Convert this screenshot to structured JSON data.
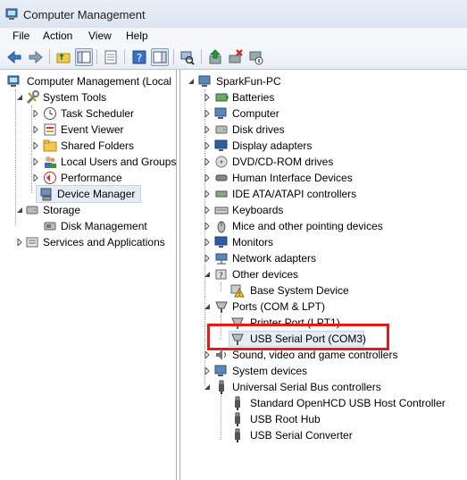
{
  "window": {
    "title": "Computer Management"
  },
  "menu": [
    "File",
    "Action",
    "View",
    "Help"
  ],
  "toolbar": {
    "back": "back-arrow-icon",
    "forward": "forward-arrow-icon",
    "up": "up-folder-icon",
    "show_tree": "console-tree-icon",
    "properties": "properties-icon",
    "help": "help-icon",
    "action_pane": "action-pane-icon",
    "scan": "scan-hardware-icon",
    "update": "update-driver-icon",
    "uninstall": "uninstall-icon",
    "disable": "disable-device-icon"
  },
  "left_tree": {
    "root": "Computer Management (Local",
    "system_tools": "System Tools",
    "task_scheduler": "Task Scheduler",
    "event_viewer": "Event Viewer",
    "shared_folders": "Shared Folders",
    "local_users": "Local Users and Groups",
    "performance": "Performance",
    "device_manager": "Device Manager",
    "storage": "Storage",
    "disk_management": "Disk Management",
    "services": "Services and Applications"
  },
  "right_tree": {
    "root": "SparkFun-PC",
    "categories": [
      "Batteries",
      "Computer",
      "Disk drives",
      "Display adapters",
      "DVD/CD-ROM drives",
      "Human Interface Devices",
      "IDE ATA/ATAPI controllers",
      "Keyboards",
      "Mice and other pointing devices",
      "Monitors",
      "Network adapters"
    ],
    "other_devices": "Other devices",
    "base_system_device": "Base System Device",
    "ports": "Ports (COM & LPT)",
    "printer_port": "Printer Port (LPT1)",
    "usb_serial_port": "USB Serial Port (COM3)",
    "sound": "Sound, video and game controllers",
    "system_devices": "System devices",
    "usb_controllers": "Universal Serial Bus controllers",
    "usb_children": [
      "Standard OpenHCD USB Host Controller",
      "USB Root Hub",
      "USB Serial Converter"
    ]
  },
  "colors": {
    "highlight_box": "#e01c1c",
    "selection": "#e5ecf5",
    "title_bg": "#dbe5f0"
  }
}
